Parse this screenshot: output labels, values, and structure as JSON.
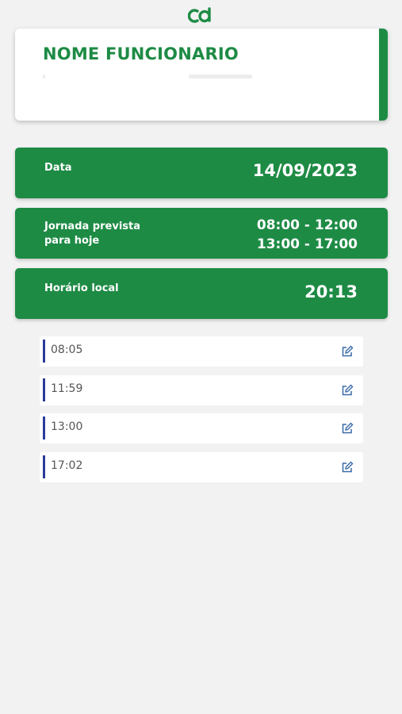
{
  "header": {
    "logo_icon": "cd-logo-icon",
    "brand_color": "#1e8b45"
  },
  "employee": {
    "name": "NOME FUNCIONARIO"
  },
  "cards": {
    "date_label": "Data",
    "date_value": "14/09/2023",
    "schedule_label_line1": "Jornada prevista",
    "schedule_label_line2": "para hoje",
    "schedule_line1": "08:00 - 12:00",
    "schedule_line2": "13:00 - 17:00",
    "local_time_label": "Horário local",
    "local_time_value": "20:13"
  },
  "entries": [
    {
      "time": "08:05",
      "icon": "edit-icon"
    },
    {
      "time": "11:59",
      "icon": "edit-icon"
    },
    {
      "time": "13:00",
      "icon": "edit-icon"
    },
    {
      "time": "17:02",
      "icon": "edit-icon"
    }
  ],
  "colors": {
    "card_green": "#1e8b45",
    "entry_marker": "#2a3a9a",
    "edit_icon": "#3a6aa8"
  }
}
